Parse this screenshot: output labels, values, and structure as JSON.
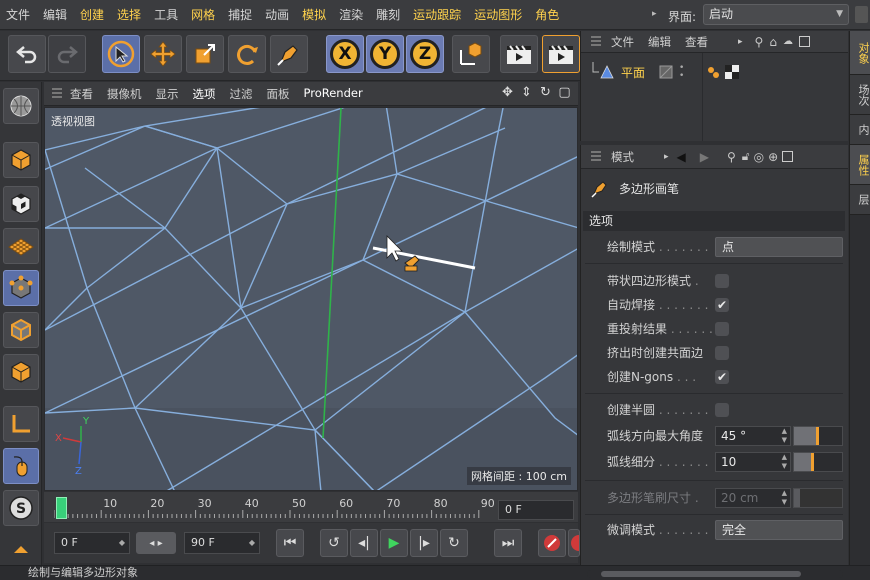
{
  "menubar": {
    "items": [
      "文件",
      "编辑",
      "创建",
      "选择",
      "工具",
      "网格",
      "捕捉",
      "动画",
      "模拟",
      "渲染",
      "雕刻",
      "运动跟踪",
      "运动图形",
      "角色"
    ],
    "highlight": [
      2,
      3,
      5,
      8,
      11,
      12,
      13
    ],
    "layout_label": "界面:",
    "layout_value": "启动"
  },
  "viewport": {
    "menus": [
      "查看",
      "摄像机",
      "显示",
      "选项",
      "过滤",
      "面板",
      "ProRender"
    ],
    "title": "透视视图",
    "grid_info": "网格间距 : 100 cm",
    "axis_labels": {
      "x": "X",
      "y": "Y",
      "z": "Z"
    }
  },
  "timeline": {
    "ticks": [
      "0",
      "10",
      "20",
      "30",
      "40",
      "50",
      "60",
      "70",
      "80",
      "90"
    ],
    "frame_field": "0 F",
    "start_field": "0 F",
    "end_field": "90 F"
  },
  "status": {
    "text": "绘制与编辑多边形对象"
  },
  "object_manager": {
    "menus": [
      "文件",
      "编辑",
      "查看"
    ],
    "object_name": "平面"
  },
  "attributes": {
    "header": "模式",
    "tool_name": "多边形画笔",
    "section": "选项",
    "draw_mode_label": "绘制模式",
    "draw_mode_value": "点",
    "strip_quad_label": "带状四边形模式",
    "auto_weld_label": "自动焊接",
    "reproject_label": "重投射结果",
    "extrude_edges_label": "挤出时创建共面边",
    "ngons_label": "创建N-gons",
    "semicircle_label": "创建半圆",
    "arc_angle_label": "弧线方向最大角度",
    "arc_angle_value": "45 °",
    "arc_sub_label": "弧线细分",
    "arc_sub_value": "10",
    "brush_size_label": "多边形笔刷尺寸",
    "brush_size_value": "20 cm",
    "tweak_label": "微调模式",
    "tweak_value": "完全",
    "checks": {
      "strip_quad": false,
      "auto_weld": true,
      "reproject": false,
      "extrude_edges": false,
      "ngons": true,
      "semicircle": false
    },
    "arc_angle_slider": 0.45,
    "arc_sub_slider": 0.35
  },
  "right_tabs": [
    "对象",
    "场次",
    "内",
    "属性",
    "层"
  ],
  "colors": {
    "accent": "#ffd24d",
    "selected": "#5b6fa8",
    "viewport_bg": "#505a68",
    "grid_line": "#7fa8d6"
  }
}
